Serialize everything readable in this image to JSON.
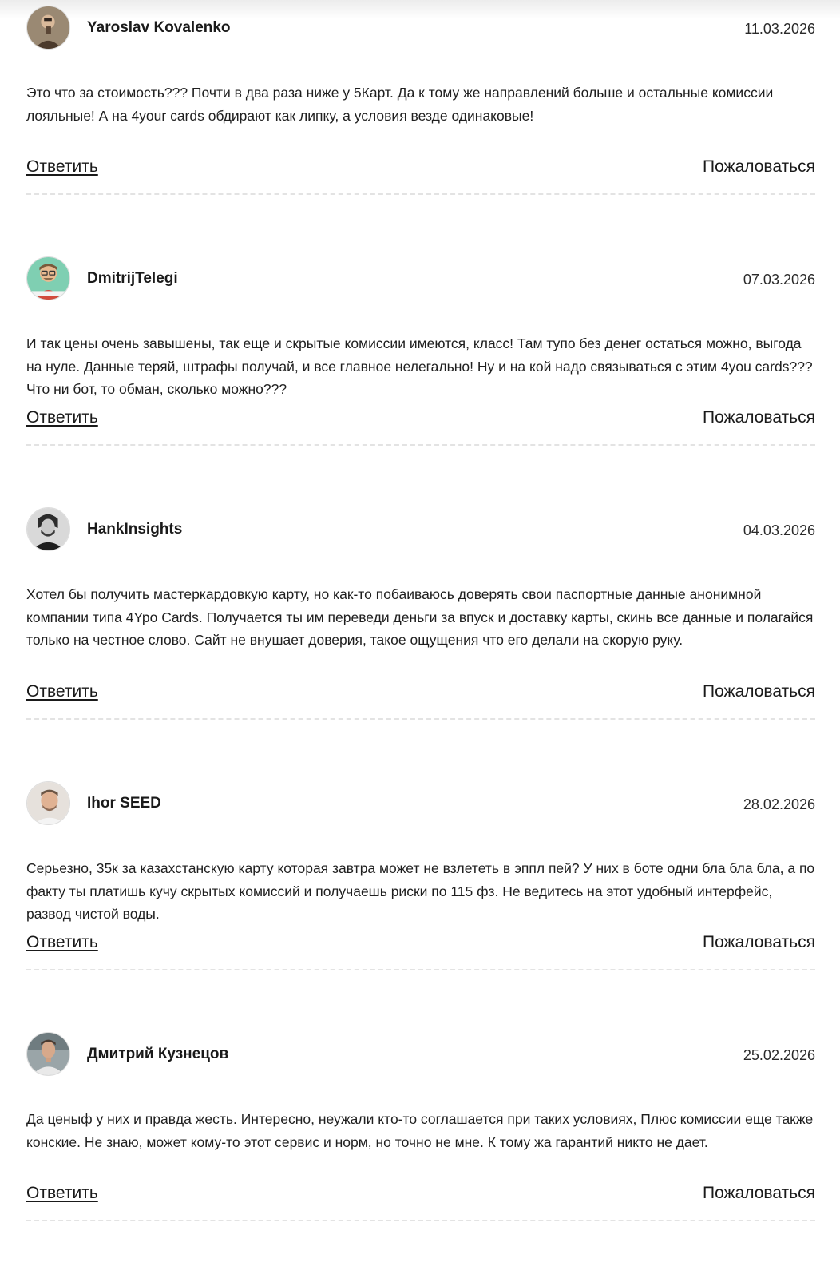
{
  "comments": [
    {
      "author": "Yaroslav Kovalenko",
      "date": "11.03.2026",
      "text": "Это что за стоимость??? Почти в два раза ниже у 5Карт. Да к тому же направлений больше и остальные комиссии лояльные! А на 4your cards обдирают как липку, а условия везде одинаковые!",
      "reply_label": "Ответить",
      "report_label": "Пожаловаться"
    },
    {
      "author": "DmitrijTelegi",
      "date": "07.03.2026",
      "text": "И так цены очень завышены, так еще и скрытые комиссии имеются, класс! Там тупо без денег остаться можно, выгода на нуле. Данные теряй, штрафы получай, и все главное нелегально! Ну и на кой надо связываться с этим 4you cards??? Что ни бот, то обман, сколько можно???",
      "reply_label": "Ответить",
      "report_label": "Пожаловаться"
    },
    {
      "author": "HankInsights",
      "date": "04.03.2026",
      "text": "Хотел бы получить мастеркардовкую карту, но как-то побаиваюсь доверять свои паспортные данные анонимной компании типа 4Ypo Cards. Получается ты им переведи деньги за впуск и доставку карты, скинь все данные и полагайся только на честное слово. Сайт не внушает доверия, такое ощущения что его делали на скорую руку.",
      "reply_label": "Ответить",
      "report_label": "Пожаловаться"
    },
    {
      "author": "Ihor SEED",
      "date": "28.02.2026",
      "text": "Серьезно, 35к за казахстанскую карту которая завтра может не взлететь в эппл пей? У них в боте одни бла бла бла, а по факту ты платишь кучу скрытых комиссий и получаешь риски по 115 фз. Не ведитесь на этот удобный интерфейс, развод чистой воды.",
      "reply_label": "Ответить",
      "report_label": "Пожаловаться"
    },
    {
      "author": "Дмитрий Кузнецов",
      "date": "25.02.2026",
      "text": "Да ценыф у них и правда жесть. Интересно, неужали кто-то соглашается при таких условиях, Плюс комиссии еще также конские. Не знаю, может кому-то этот сервис и норм, но точно не мне. К тому жа гарантий никто не дает.",
      "reply_label": "Ответить",
      "report_label": "Пожаловаться"
    }
  ]
}
